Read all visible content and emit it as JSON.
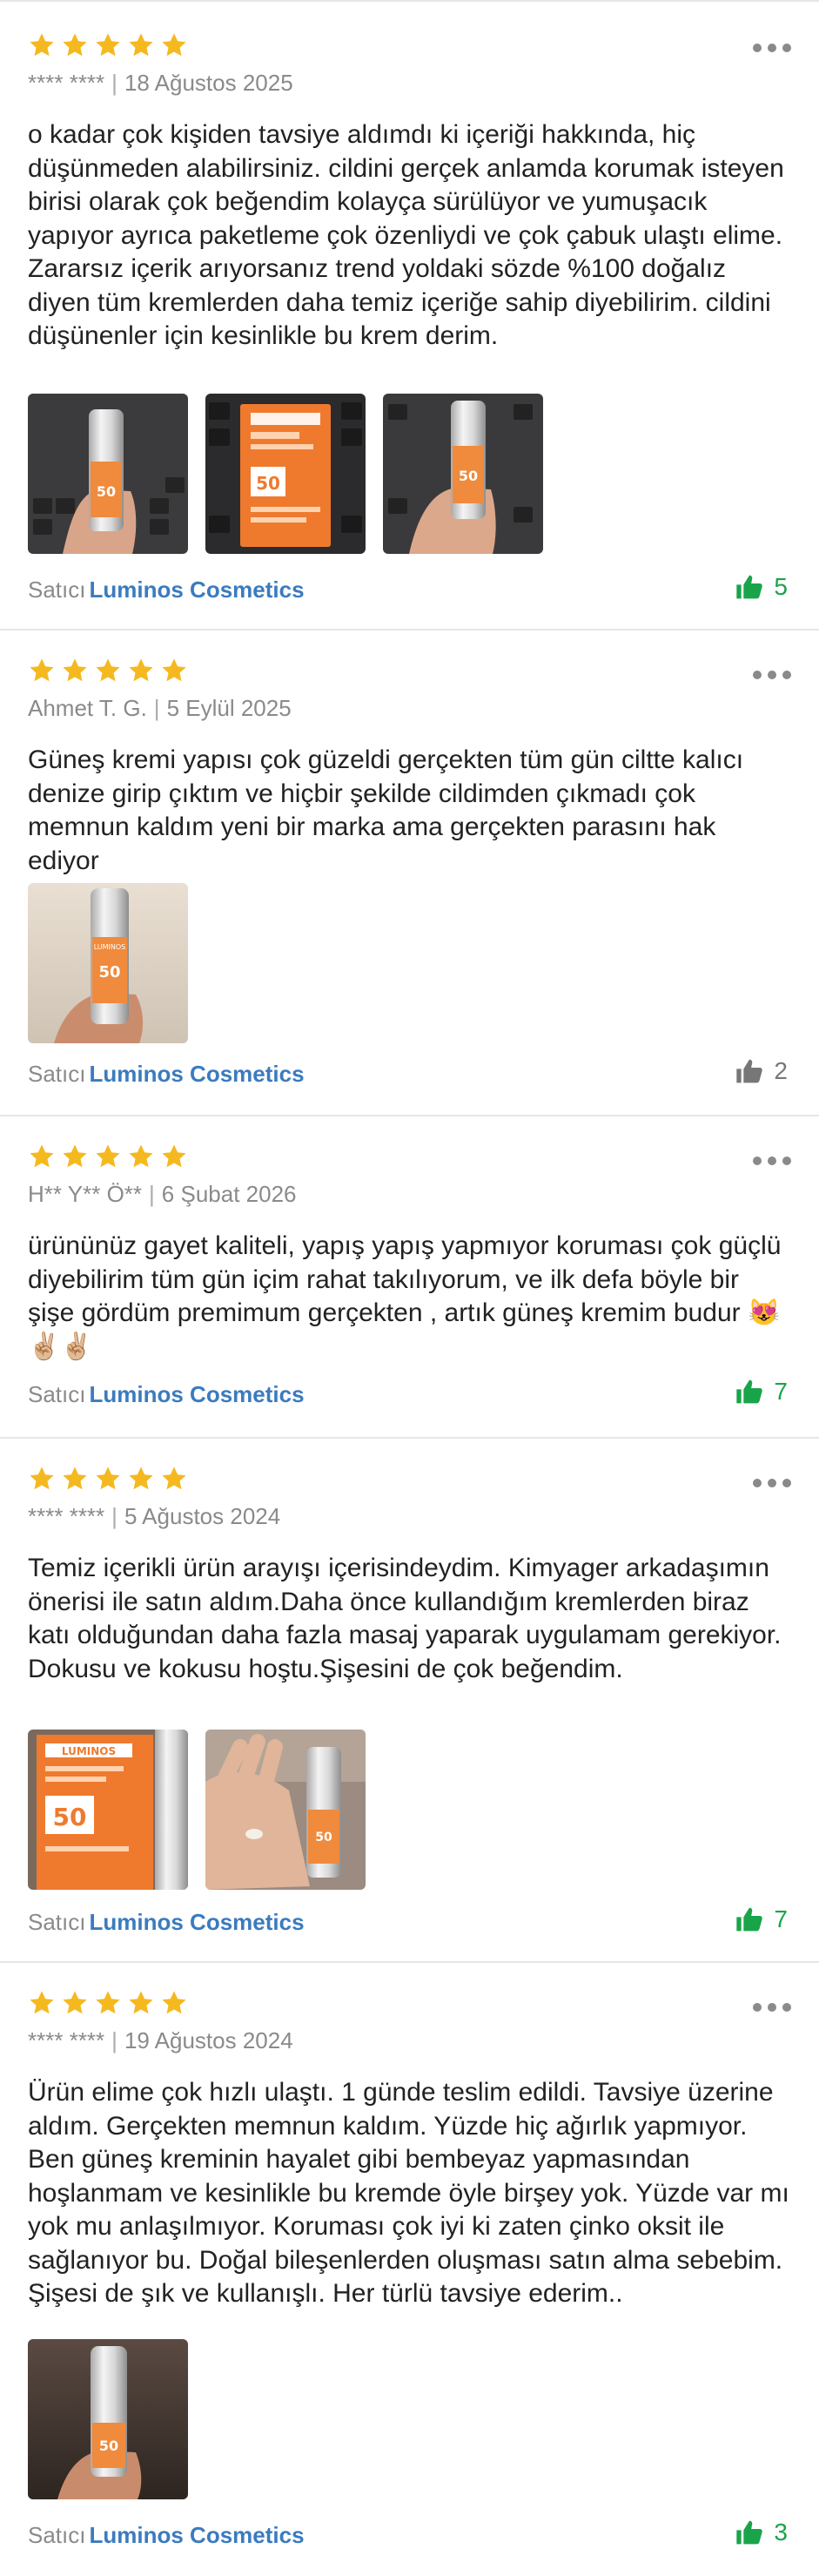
{
  "colors": {
    "star": "#F5B920",
    "seller_link": "#3B7BBF",
    "like_active": "#1AA44A",
    "like_inactive": "#777777",
    "meta_text": "#8A8A8A"
  },
  "icons": {
    "star": "star-icon",
    "more": "more-options-icon",
    "like": "thumbs-up-icon"
  },
  "reviews": [
    {
      "rating": 5,
      "author": "**** ****",
      "date": "18 Ağustos 2025",
      "text": "o kadar çok kişiden tavsiye aldımdı ki içeriği hakkında, hiç düşünmeden alabilirsiniz. cildini gerçek anlamda korumak isteyen birisi olarak çok beğendim kolayça sürülüyor ve yumuşacık yapıyor ayrıca paketleme çok özenliydi ve çok çabuk ulaştı elime. Zararsız içerik arıyorsanız trend yoldaki sözde %100 doğalız diyen tüm kremlerden daha temiz içeriğe sahip diyebilirim. cildini düşünenler için kesinlikle bu krem derim.",
      "photos": [
        "tube-in-hand-keyboard",
        "box-on-keyboard",
        "tube-in-hand-keyboard"
      ],
      "seller_prefix": "Satıcı",
      "seller_name": "Luminos Cosmetics",
      "likes": "5",
      "liked": true
    },
    {
      "rating": 5,
      "author": "Ahmet T. G.",
      "date": "5 Eylül 2025",
      "text": "Güneş kremi yapısı çok güzeldi gerçekten tüm gün ciltte kalıcı denize girip çıktım ve hiçbir şekilde cildimden çıkmadı çok memnun kaldım yeni bir marka ama gerçekten parasını hak ediyor",
      "photos": [
        "tube-in-hand"
      ],
      "seller_prefix": "Satıcı",
      "seller_name": "Luminos Cosmetics",
      "likes": "2",
      "liked": false
    },
    {
      "rating": 5,
      "author": "H** Y** Ö**",
      "date": "6 Şubat 2026",
      "text": "ürününüz gayet kaliteli, yapış yapış yapmıyor koruması çok güçlü diyebilirim tüm gün içim rahat takılıyorum, ve ilk defa böyle bir şişe gördüm premimum gerçekten , artık güneş kremim budur",
      "emoji": "😻✌🏼✌🏼",
      "photos": [],
      "seller_prefix": "Satıcı",
      "seller_name": "Luminos Cosmetics",
      "likes": "7",
      "liked": true
    },
    {
      "rating": 5,
      "author": "**** ****",
      "date": "5 Ağustos 2024",
      "text": "Temiz içerikli ürün arayışı içerisindeydim. Kimyager arkadaşımın önerisi ile satın aldım.Daha önce kullandığım kremlerden biraz katı olduğundan daha fazla masaj yaparak uygulamam gerekiyor. Dokusu ve kokusu hoştu.Şişesini de çok beğendim.",
      "photos": [
        "product-box-closeup",
        "cream-on-hand"
      ],
      "seller_prefix": "Satıcı",
      "seller_name": "Luminos Cosmetics",
      "likes": "7",
      "liked": true
    },
    {
      "rating": 5,
      "author": "**** ****",
      "date": "19 Ağustos 2024",
      "text": "Ürün elime çok hızlı ulaştı. 1 günde teslim edildi. Tavsiye üzerine aldım. Gerçekten memnun kaldım. Yüzde hiç ağırlık yapmıyor. Ben güneş kreminin hayalet gibi bembeyaz yapmasından hoşlanmam ve kesinlikle bu kremde öyle birşey yok. Yüzde var mı yok mu anlaşılmıyor. Koruması çok iyi ki zaten çinko oksit ile sağlanıyor bu. Doğal bileşenlerden oluşması satın alma sebebim. Şişesi de şık ve kullanışlı. Her türlü tavsiye ederim..",
      "photos": [
        "tube-in-hand-dark"
      ],
      "seller_prefix": "Satıcı",
      "seller_name": "Luminos Cosmetics",
      "likes": "3",
      "liked": true
    }
  ]
}
